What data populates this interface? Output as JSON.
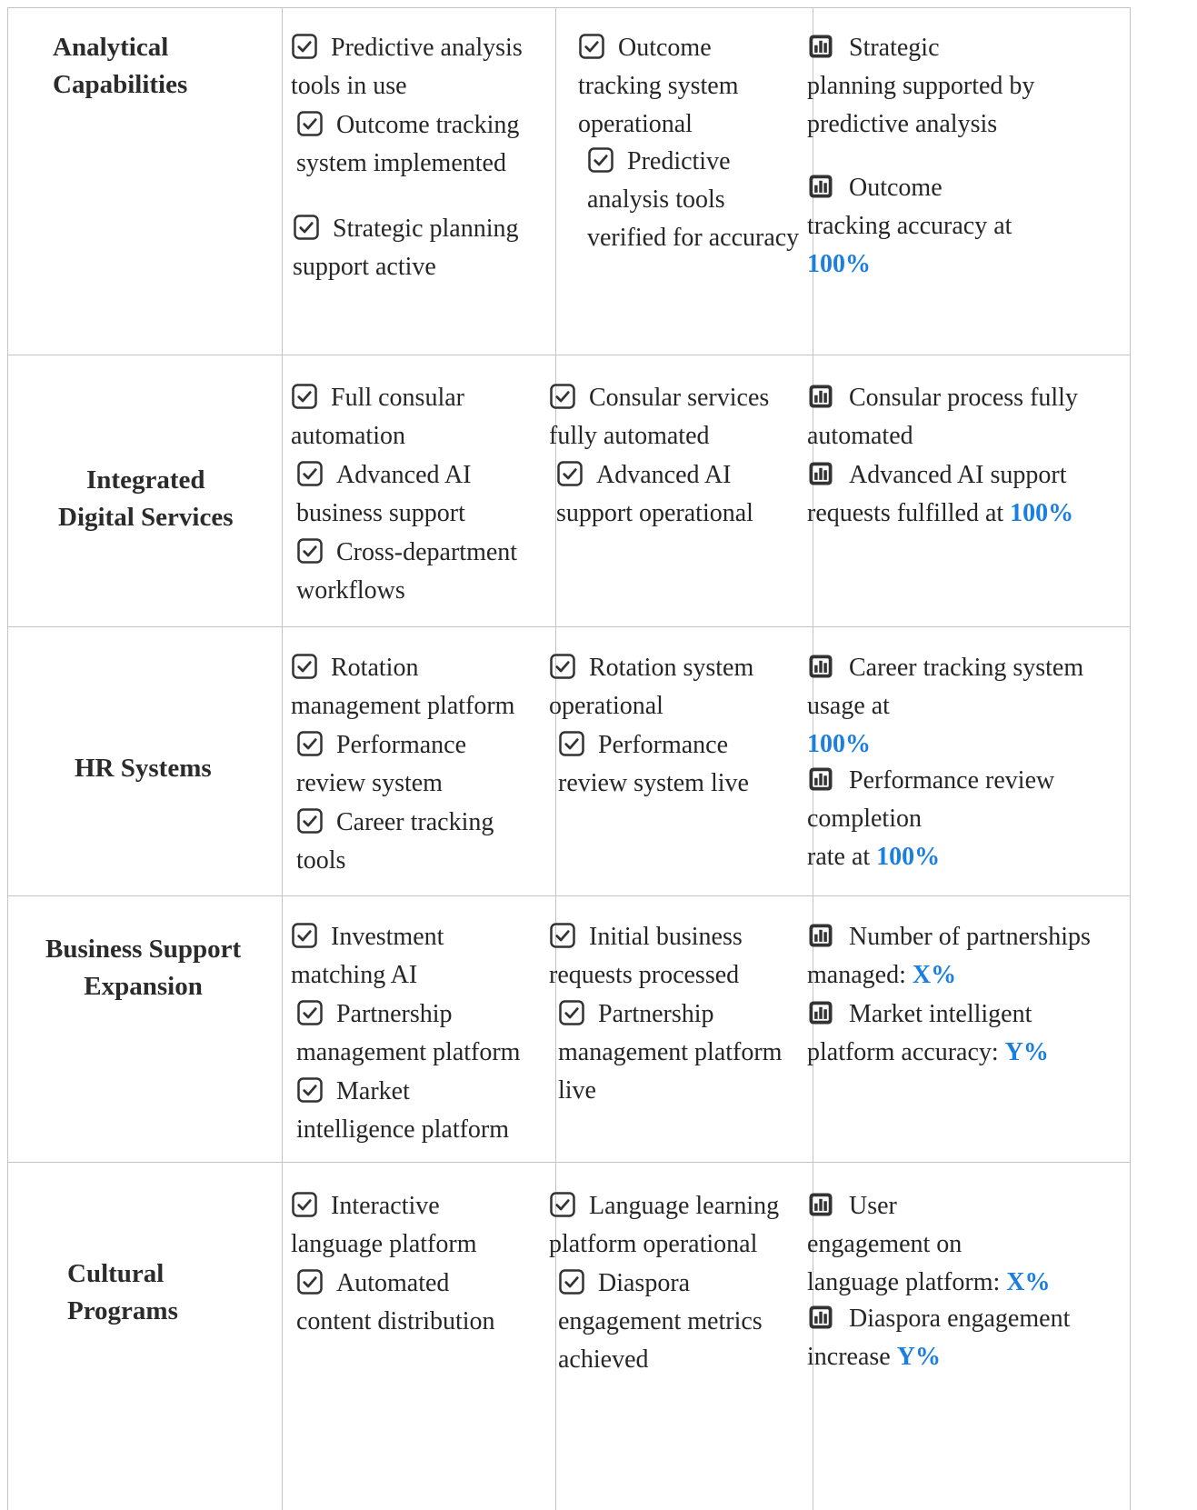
{
  "rows": [
    {
      "label": [
        "Analytical",
        "Capabilities"
      ],
      "planned": [
        {
          "lines": [
            "Predictive analysis",
            "tools in use"
          ]
        },
        {
          "lines": [
            "Outcome tracking",
            "system implemented"
          ]
        },
        {
          "lines": [
            "Strategic planning",
            "support active"
          ]
        }
      ],
      "achieved": [
        {
          "lines": [
            "Outcome",
            "tracking system",
            "operational"
          ]
        },
        {
          "lines": [
            "Predictive",
            "analysis tools",
            "verified for accuracy"
          ]
        }
      ],
      "metrics": [
        {
          "lines": [
            "Strategic",
            "planning supported by",
            "predictive analysis"
          ]
        },
        {
          "lines": [
            "Outcome",
            "tracking accuracy at"
          ],
          "value": "100%"
        }
      ]
    },
    {
      "label": [
        "Integrated",
        "Digital Services"
      ],
      "planned": [
        {
          "lines": [
            "Full consular",
            "automation"
          ]
        },
        {
          "lines": [
            "Advanced AI",
            "business support"
          ]
        },
        {
          "lines": [
            "Cross-department",
            "workflows"
          ]
        }
      ],
      "achieved": [
        {
          "lines": [
            "Consular services",
            "fully automated"
          ]
        },
        {
          "lines": [
            "Advanced AI",
            "support operational"
          ]
        }
      ],
      "metrics": [
        {
          "lines": [
            "Consular process fully",
            "automated"
          ]
        },
        {
          "lines": [
            "Advanced AI support",
            "requests fulfilled at"
          ],
          "value": "100%"
        }
      ]
    },
    {
      "label": [
        "HR Systems"
      ],
      "planned": [
        {
          "lines": [
            "Rotation",
            "management platform"
          ]
        },
        {
          "lines": [
            "Performance",
            "review system"
          ]
        },
        {
          "lines": [
            "Career tracking",
            "tools"
          ]
        }
      ],
      "achieved": [
        {
          "lines": [
            "Rotation system",
            "operational"
          ]
        },
        {
          "lines": [
            "Performance",
            "review system live"
          ]
        }
      ],
      "metrics": [
        {
          "lines": [
            "Career tracking system",
            "usage at"
          ],
          "value": "100%"
        },
        {
          "lines": [
            "Performance review",
            "completion",
            "rate at"
          ],
          "value": "100%"
        }
      ]
    },
    {
      "label": [
        "Business Support",
        "Expansion"
      ],
      "planned": [
        {
          "lines": [
            "Investment",
            "matching AI"
          ]
        },
        {
          "lines": [
            "Partnership",
            "management platform"
          ]
        },
        {
          "lines": [
            "Market",
            "intelligence platform"
          ]
        }
      ],
      "achieved": [
        {
          "lines": [
            "Initial business",
            "requests processed"
          ]
        },
        {
          "lines": [
            "Partnership",
            "management platform",
            "live"
          ]
        }
      ],
      "metrics": [
        {
          "lines": [
            "Number of partnerships",
            "managed:"
          ],
          "value": "X%"
        },
        {
          "lines": [
            "Market intelligent",
            "platform accuracy:"
          ],
          "value": "Y%"
        }
      ]
    },
    {
      "label": [
        "Cultural",
        "Programs"
      ],
      "planned": [
        {
          "lines": [
            "Interactive",
            "language platform"
          ]
        },
        {
          "lines": [
            "Automated",
            "content distribution"
          ]
        }
      ],
      "achieved": [
        {
          "lines": [
            "Language learning",
            "platform operational"
          ]
        },
        {
          "lines": [
            "Diaspora",
            "engagement metrics",
            "achieved"
          ]
        }
      ],
      "metrics": [
        {
          "lines": [
            "User",
            "engagement on",
            "language platform:"
          ],
          "value": "X%"
        },
        {
          "lines": [
            "Diaspora engagement",
            "increase"
          ],
          "value": "Y%"
        }
      ]
    }
  ],
  "icons": {
    "planned": "check-square-icon",
    "achieved": "check-square-icon",
    "metrics": "bar-chart-icon"
  },
  "colors": {
    "value": "#1a7fe0",
    "border": "#c4c4c4",
    "text": "#262626"
  }
}
